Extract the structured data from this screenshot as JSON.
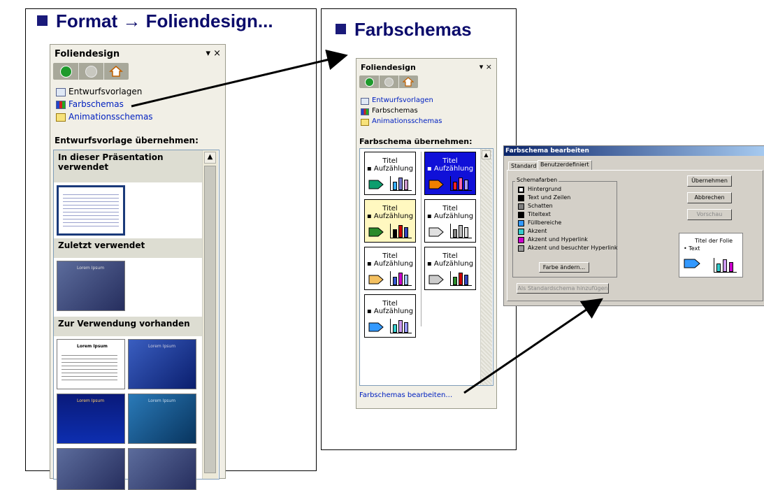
{
  "left": {
    "heading": "Format → Foliendesign...",
    "pane": {
      "title": "Foliendesign",
      "controls": "▾ ×",
      "links": [
        "Entwurfsvorlagen",
        "Farbschemas",
        "Animationsschemas"
      ],
      "section": "Entwurfsvorlage übernehmen:",
      "groups": [
        "In dieser Präsentation verwendet",
        "Zuletzt verwendet",
        "Zur Verwendung vorhanden"
      ],
      "thumb_text": "Lorem Ipsum"
    }
  },
  "middle": {
    "heading": "Farbschemas",
    "pane": {
      "title": "Foliendesign",
      "controls": "▾ ×",
      "links": [
        "Entwurfsvorlagen",
        "Farbschemas",
        "Animationsschemas"
      ],
      "section": "Farbschema übernehmen:",
      "scheme_title": "Titel",
      "scheme_bullet": "▪ Aufzählung",
      "footer_link": "Farbschemas bearbeiten…"
    },
    "schemes": [
      {
        "bg": "#ffffff",
        "text": "#000000",
        "arrow": "#0e9e6e",
        "bars": [
          "#33aaff",
          "#7777cc",
          "#cc99cc"
        ]
      },
      {
        "bg": "#1010d8",
        "text": "#ffffff",
        "arrow": "#f08000",
        "bars": [
          "#ff2020",
          "#ff66aa",
          "#aa99ff"
        ]
      },
      {
        "bg": "#fff8c0",
        "text": "#000000",
        "arrow": "#2a8a2a",
        "bars": [
          "#000000",
          "#cc0000",
          "#3344bb"
        ]
      },
      {
        "bg": "#ffffff",
        "text": "#000000",
        "arrow": "#e0e0e0",
        "bars": [
          "#808080",
          "#bbbbbb",
          "#dddddd"
        ]
      },
      {
        "bg": "#ffffff",
        "text": "#000000",
        "arrow": "#f4c060",
        "bars": [
          "#3355cc",
          "#cc00cc",
          "#99bbee"
        ]
      },
      {
        "bg": "#ffffff",
        "text": "#000000",
        "arrow": "#cccccc",
        "bars": [
          "#2a8a2a",
          "#cc0000",
          "#3344bb"
        ]
      },
      {
        "bg": "#ffffff",
        "text": "#000000",
        "arrow": "#3399ff",
        "bars": [
          "#33cccc",
          "#cc99ee",
          "#9999ff"
        ]
      }
    ]
  },
  "dialog": {
    "title": "Farbschema bearbeiten",
    "tabs": [
      "Standard",
      "Benutzerdefiniert"
    ],
    "group_label": "Schemafarben",
    "colors": [
      {
        "label": "Hintergrund",
        "color": "#ffffff"
      },
      {
        "label": "Text und Zeilen",
        "color": "#000000"
      },
      {
        "label": "Schatten",
        "color": "#808080"
      },
      {
        "label": "Titeltext",
        "color": "#000000"
      },
      {
        "label": "Füllbereiche",
        "color": "#3399ff"
      },
      {
        "label": "Akzent",
        "color": "#33cccc"
      },
      {
        "label": "Akzent und Hyperlink",
        "color": "#cc00cc"
      },
      {
        "label": "Akzent und besuchter Hyperlink",
        "color": "#999999"
      }
    ],
    "change_button": "Farbe ändern...",
    "add_standard_button": "Als Standardschema hinzufügen",
    "buttons": [
      "Übernehmen",
      "Abbrechen",
      "Vorschau"
    ],
    "preview_title": "Titel der Folie",
    "preview_text": "• Text"
  }
}
